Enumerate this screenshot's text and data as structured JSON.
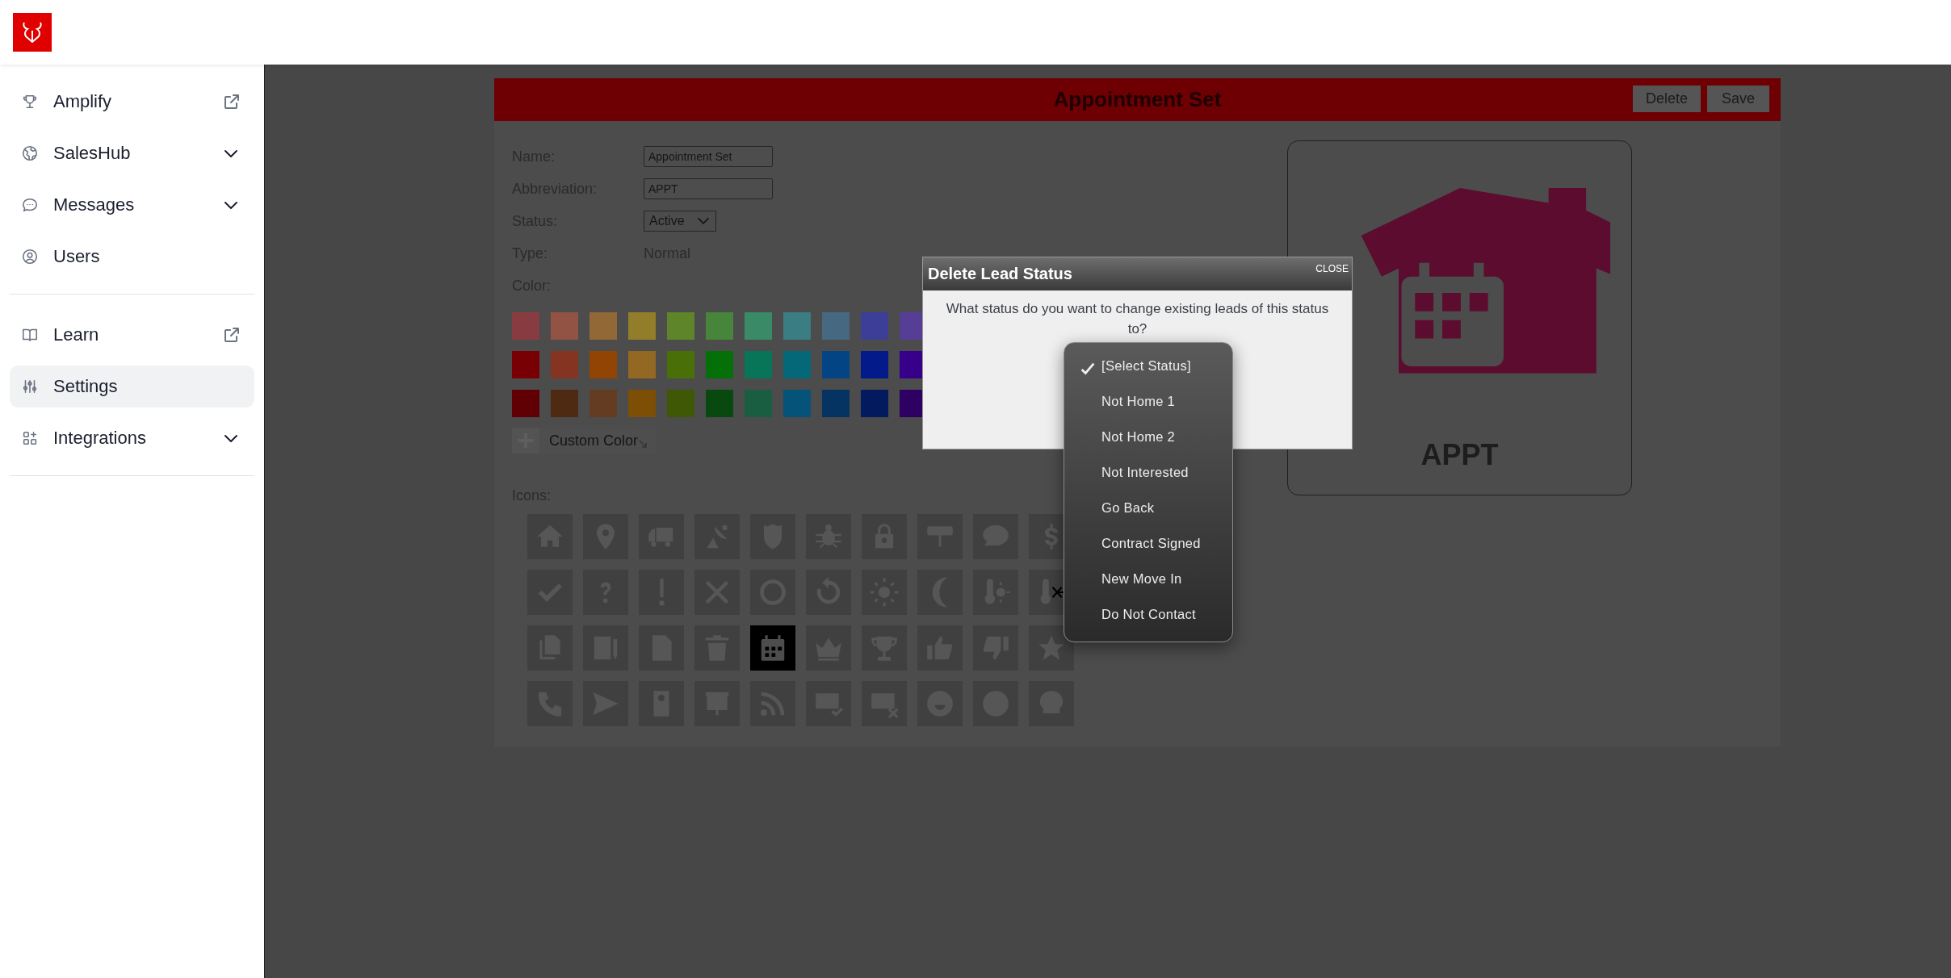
{
  "sidebar": {
    "groups": [
      {
        "items": [
          {
            "label": "Amplify",
            "selected": false,
            "kind": "external"
          },
          {
            "label": "SalesHub",
            "selected": false,
            "kind": "dropdown",
            "expanded": false
          },
          {
            "label": "Messages",
            "selected": false,
            "kind": "dropdown",
            "expanded": false
          },
          {
            "label": "Users",
            "selected": false,
            "kind": "plain"
          }
        ]
      },
      {
        "items": [
          {
            "label": "Learn",
            "selected": false,
            "kind": "external"
          },
          {
            "label": "Settings",
            "selected": true,
            "kind": "plain"
          },
          {
            "label": "Integrations",
            "selected": false,
            "kind": "dropdown",
            "expanded": false
          }
        ]
      }
    ]
  },
  "editor": {
    "title": "Appointment Set",
    "buttons": [
      "Delete",
      "Save"
    ],
    "fields": [
      {
        "label": "Name:",
        "kind": "input",
        "value": "Appointment Set"
      },
      {
        "label": "Abbreviation:",
        "kind": "input",
        "value": "APPT"
      },
      {
        "label": "Status:",
        "kind": "select",
        "value": "Active"
      },
      {
        "label": "Type:",
        "kind": "text",
        "value": "Normal"
      }
    ],
    "color_label": "Color:",
    "swatches": [
      [
        {
          "color": "#883c41"
        },
        {
          "color": "#925344"
        },
        {
          "color": "#926837"
        },
        {
          "color": "#927d2a"
        },
        {
          "color": "#5e852a"
        },
        {
          "color": "#46853a"
        },
        {
          "color": "#3a8a68"
        },
        {
          "color": "#3a7d82"
        },
        {
          "color": "#466880"
        },
        {
          "color": "#3c3e97"
        },
        {
          "color": "#563e97"
        }
      ],
      [
        {
          "color": "#780005"
        },
        {
          "color": "#853422"
        },
        {
          "color": "#924405"
        },
        {
          "color": "#926822"
        },
        {
          "color": "#497008"
        },
        {
          "color": "#057008"
        },
        {
          "color": "#087558"
        },
        {
          "color": "#056878"
        },
        {
          "color": "#034485"
        },
        {
          "color": "#031a8a"
        },
        {
          "color": "#37008a"
        }
      ],
      [
        {
          "color": "#600005"
        },
        {
          "color": "#4e2a12"
        },
        {
          "color": "#633c22"
        },
        {
          "color": "#7d4e05"
        },
        {
          "color": "#3e5805"
        },
        {
          "color": "#08490f"
        },
        {
          "color": "#1a5e41"
        },
        {
          "color": "#055378"
        },
        {
          "color": "#053463"
        },
        {
          "color": "#031a5e"
        },
        {
          "color": "#2f0063"
        }
      ]
    ],
    "custom_color": "Custom Color",
    "icons_label": "Icons:",
    "icons": [
      {
        "selected": false
      },
      {
        "selected": false
      },
      {
        "selected": false
      },
      {
        "selected": false
      },
      {
        "selected": false
      },
      {
        "selected": false
      },
      {
        "selected": false
      },
      {
        "selected": false
      },
      {
        "selected": false
      },
      {
        "selected": false
      },
      {
        "selected": false
      },
      {
        "selected": false
      },
      {
        "selected": false
      },
      {
        "selected": false
      },
      {
        "selected": false
      },
      {
        "selected": false
      },
      {
        "selected": false
      },
      {
        "selected": false
      },
      {
        "selected": false
      },
      {
        "selected": false
      },
      {
        "selected": false
      },
      {
        "selected": false
      },
      {
        "selected": false
      },
      {
        "selected": false
      },
      {
        "selected": true
      },
      {
        "selected": false
      },
      {
        "selected": false
      },
      {
        "selected": false
      },
      {
        "selected": false
      },
      {
        "selected": false
      },
      {
        "selected": false
      },
      {
        "selected": false
      },
      {
        "selected": false
      },
      {
        "selected": false
      },
      {
        "selected": false
      },
      {
        "selected": false
      },
      {
        "selected": false
      },
      {
        "selected": false
      },
      {
        "selected": false
      },
      {
        "selected": false
      }
    ],
    "preview": {
      "abbreviation": "APPT"
    }
  },
  "dialog": {
    "title": "Delete Lead Status",
    "close": "CLOSE",
    "message": "What status do you want to change existing leads of this status to?",
    "options": [
      {
        "label": "[Select Status]",
        "selected": true
      },
      {
        "label": "Not Home 1",
        "selected": false
      },
      {
        "label": "Not Home 2",
        "selected": false
      },
      {
        "label": "Not Interested",
        "selected": false
      },
      {
        "label": "Go Back",
        "selected": false
      },
      {
        "label": "Contract Signed",
        "selected": false
      },
      {
        "label": "New Move In",
        "selected": false
      },
      {
        "label": "Do Not Contact",
        "selected": false
      }
    ]
  }
}
